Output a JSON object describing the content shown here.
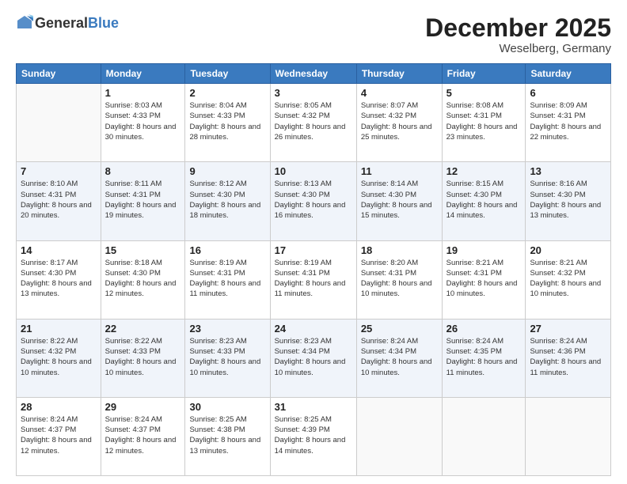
{
  "logo": {
    "general": "General",
    "blue": "Blue"
  },
  "header": {
    "month": "December 2025",
    "location": "Weselberg, Germany"
  },
  "weekdays": [
    "Sunday",
    "Monday",
    "Tuesday",
    "Wednesday",
    "Thursday",
    "Friday",
    "Saturday"
  ],
  "weeks": [
    [
      {
        "day": "",
        "sunrise": "",
        "sunset": "",
        "daylight": ""
      },
      {
        "day": "1",
        "sunrise": "Sunrise: 8:03 AM",
        "sunset": "Sunset: 4:33 PM",
        "daylight": "Daylight: 8 hours and 30 minutes."
      },
      {
        "day": "2",
        "sunrise": "Sunrise: 8:04 AM",
        "sunset": "Sunset: 4:33 PM",
        "daylight": "Daylight: 8 hours and 28 minutes."
      },
      {
        "day": "3",
        "sunrise": "Sunrise: 8:05 AM",
        "sunset": "Sunset: 4:32 PM",
        "daylight": "Daylight: 8 hours and 26 minutes."
      },
      {
        "day": "4",
        "sunrise": "Sunrise: 8:07 AM",
        "sunset": "Sunset: 4:32 PM",
        "daylight": "Daylight: 8 hours and 25 minutes."
      },
      {
        "day": "5",
        "sunrise": "Sunrise: 8:08 AM",
        "sunset": "Sunset: 4:31 PM",
        "daylight": "Daylight: 8 hours and 23 minutes."
      },
      {
        "day": "6",
        "sunrise": "Sunrise: 8:09 AM",
        "sunset": "Sunset: 4:31 PM",
        "daylight": "Daylight: 8 hours and 22 minutes."
      }
    ],
    [
      {
        "day": "7",
        "sunrise": "Sunrise: 8:10 AM",
        "sunset": "Sunset: 4:31 PM",
        "daylight": "Daylight: 8 hours and 20 minutes."
      },
      {
        "day": "8",
        "sunrise": "Sunrise: 8:11 AM",
        "sunset": "Sunset: 4:31 PM",
        "daylight": "Daylight: 8 hours and 19 minutes."
      },
      {
        "day": "9",
        "sunrise": "Sunrise: 8:12 AM",
        "sunset": "Sunset: 4:30 PM",
        "daylight": "Daylight: 8 hours and 18 minutes."
      },
      {
        "day": "10",
        "sunrise": "Sunrise: 8:13 AM",
        "sunset": "Sunset: 4:30 PM",
        "daylight": "Daylight: 8 hours and 16 minutes."
      },
      {
        "day": "11",
        "sunrise": "Sunrise: 8:14 AM",
        "sunset": "Sunset: 4:30 PM",
        "daylight": "Daylight: 8 hours and 15 minutes."
      },
      {
        "day": "12",
        "sunrise": "Sunrise: 8:15 AM",
        "sunset": "Sunset: 4:30 PM",
        "daylight": "Daylight: 8 hours and 14 minutes."
      },
      {
        "day": "13",
        "sunrise": "Sunrise: 8:16 AM",
        "sunset": "Sunset: 4:30 PM",
        "daylight": "Daylight: 8 hours and 13 minutes."
      }
    ],
    [
      {
        "day": "14",
        "sunrise": "Sunrise: 8:17 AM",
        "sunset": "Sunset: 4:30 PM",
        "daylight": "Daylight: 8 hours and 13 minutes."
      },
      {
        "day": "15",
        "sunrise": "Sunrise: 8:18 AM",
        "sunset": "Sunset: 4:30 PM",
        "daylight": "Daylight: 8 hours and 12 minutes."
      },
      {
        "day": "16",
        "sunrise": "Sunrise: 8:19 AM",
        "sunset": "Sunset: 4:31 PM",
        "daylight": "Daylight: 8 hours and 11 minutes."
      },
      {
        "day": "17",
        "sunrise": "Sunrise: 8:19 AM",
        "sunset": "Sunset: 4:31 PM",
        "daylight": "Daylight: 8 hours and 11 minutes."
      },
      {
        "day": "18",
        "sunrise": "Sunrise: 8:20 AM",
        "sunset": "Sunset: 4:31 PM",
        "daylight": "Daylight: 8 hours and 10 minutes."
      },
      {
        "day": "19",
        "sunrise": "Sunrise: 8:21 AM",
        "sunset": "Sunset: 4:31 PM",
        "daylight": "Daylight: 8 hours and 10 minutes."
      },
      {
        "day": "20",
        "sunrise": "Sunrise: 8:21 AM",
        "sunset": "Sunset: 4:32 PM",
        "daylight": "Daylight: 8 hours and 10 minutes."
      }
    ],
    [
      {
        "day": "21",
        "sunrise": "Sunrise: 8:22 AM",
        "sunset": "Sunset: 4:32 PM",
        "daylight": "Daylight: 8 hours and 10 minutes."
      },
      {
        "day": "22",
        "sunrise": "Sunrise: 8:22 AM",
        "sunset": "Sunset: 4:33 PM",
        "daylight": "Daylight: 8 hours and 10 minutes."
      },
      {
        "day": "23",
        "sunrise": "Sunrise: 8:23 AM",
        "sunset": "Sunset: 4:33 PM",
        "daylight": "Daylight: 8 hours and 10 minutes."
      },
      {
        "day": "24",
        "sunrise": "Sunrise: 8:23 AM",
        "sunset": "Sunset: 4:34 PM",
        "daylight": "Daylight: 8 hours and 10 minutes."
      },
      {
        "day": "25",
        "sunrise": "Sunrise: 8:24 AM",
        "sunset": "Sunset: 4:34 PM",
        "daylight": "Daylight: 8 hours and 10 minutes."
      },
      {
        "day": "26",
        "sunrise": "Sunrise: 8:24 AM",
        "sunset": "Sunset: 4:35 PM",
        "daylight": "Daylight: 8 hours and 11 minutes."
      },
      {
        "day": "27",
        "sunrise": "Sunrise: 8:24 AM",
        "sunset": "Sunset: 4:36 PM",
        "daylight": "Daylight: 8 hours and 11 minutes."
      }
    ],
    [
      {
        "day": "28",
        "sunrise": "Sunrise: 8:24 AM",
        "sunset": "Sunset: 4:37 PM",
        "daylight": "Daylight: 8 hours and 12 minutes."
      },
      {
        "day": "29",
        "sunrise": "Sunrise: 8:24 AM",
        "sunset": "Sunset: 4:37 PM",
        "daylight": "Daylight: 8 hours and 12 minutes."
      },
      {
        "day": "30",
        "sunrise": "Sunrise: 8:25 AM",
        "sunset": "Sunset: 4:38 PM",
        "daylight": "Daylight: 8 hours and 13 minutes."
      },
      {
        "day": "31",
        "sunrise": "Sunrise: 8:25 AM",
        "sunset": "Sunset: 4:39 PM",
        "daylight": "Daylight: 8 hours and 14 minutes."
      },
      {
        "day": "",
        "sunrise": "",
        "sunset": "",
        "daylight": ""
      },
      {
        "day": "",
        "sunrise": "",
        "sunset": "",
        "daylight": ""
      },
      {
        "day": "",
        "sunrise": "",
        "sunset": "",
        "daylight": ""
      }
    ]
  ]
}
